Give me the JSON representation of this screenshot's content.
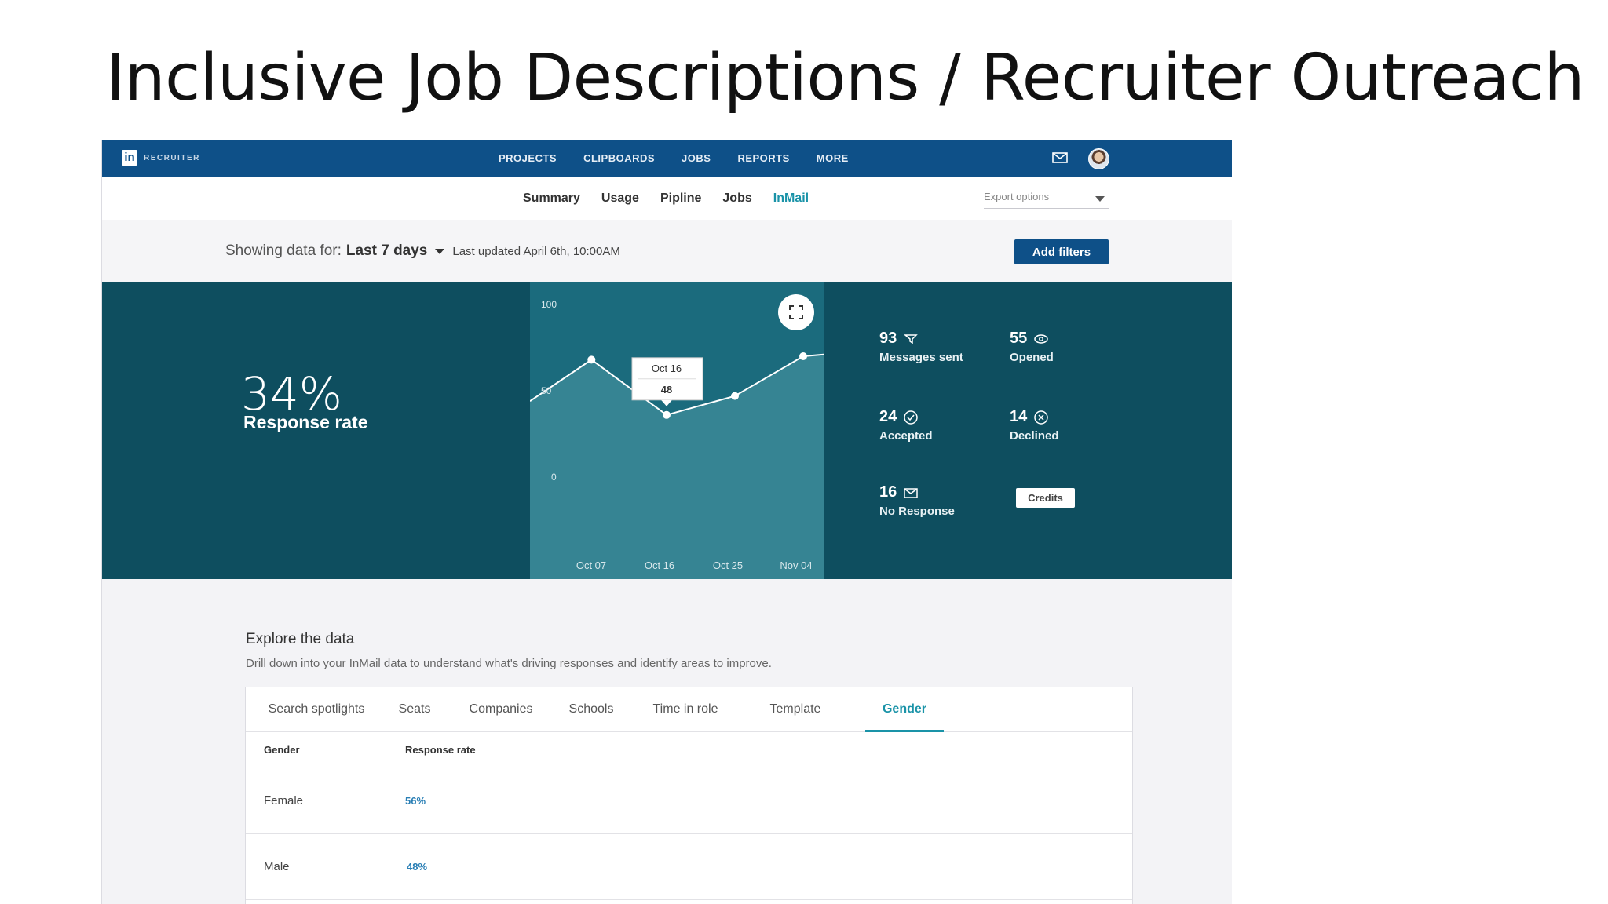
{
  "slide": {
    "title": "Inclusive Job Descriptions / Recruiter Outreach"
  },
  "app": {
    "logo_text": "RECRUITER",
    "nav": [
      "PROJECTS",
      "CLIPBOARDS",
      "JOBS",
      "REPORTS",
      "MORE"
    ],
    "subnav_tabs": [
      "Summary",
      "Usage",
      "Pipline",
      "Jobs",
      "InMail"
    ],
    "active_subnav": "InMail",
    "export_placeholder": "Export options"
  },
  "filters": {
    "showing_label": "Showing data for:",
    "range": "Last 7 days",
    "last_updated": "Last updated April 6th, 10:00AM",
    "add_filters": "Add filters"
  },
  "summary": {
    "response_rate": "34%",
    "response_rate_label": "Response rate",
    "stats": [
      {
        "value": "93",
        "label": "Messages sent",
        "icon": "message-sent-icon"
      },
      {
        "value": "55",
        "label": "Opened",
        "icon": "eye-icon"
      },
      {
        "value": "24",
        "label": "Accepted",
        "icon": "check-circle-icon"
      },
      {
        "value": "14",
        "label": "Declined",
        "icon": "x-circle-icon"
      },
      {
        "value": "16",
        "label": "No Response",
        "icon": "envelope-icon"
      }
    ],
    "credits_label": "Credits"
  },
  "chart_data": {
    "type": "area",
    "x_ticks": [
      "Oct 07",
      "Oct 16",
      "Oct 25",
      "Nov 04"
    ],
    "y_ticks": [
      "100",
      "50",
      "0"
    ],
    "ylim": [
      0,
      100
    ],
    "points": [
      {
        "x": 0,
        "y": 44
      },
      {
        "x": 0.9,
        "y": 68
      },
      {
        "x": 2,
        "y": 36
      },
      {
        "x": 3,
        "y": 47
      },
      {
        "x": 4,
        "y": 70
      },
      {
        "x": 4.3,
        "y": 71
      }
    ],
    "tooltip": {
      "label": "Oct 16",
      "value": "48"
    },
    "colors": {
      "area": "#3a8796",
      "line": "#ffffff"
    }
  },
  "explore": {
    "title": "Explore the data",
    "description": "Drill down into your InMail data to understand what's driving responses and identify areas to improve.",
    "tabs": [
      "Search spotlights",
      "Seats",
      "Companies",
      "Schools",
      "Time in role",
      "Template",
      "Gender"
    ],
    "active_tab": "Gender",
    "columns": [
      "Gender",
      "Response rate"
    ],
    "rows": [
      {
        "gender": "Female",
        "rate": "56%"
      },
      {
        "gender": "Male",
        "rate": "48%"
      }
    ]
  }
}
